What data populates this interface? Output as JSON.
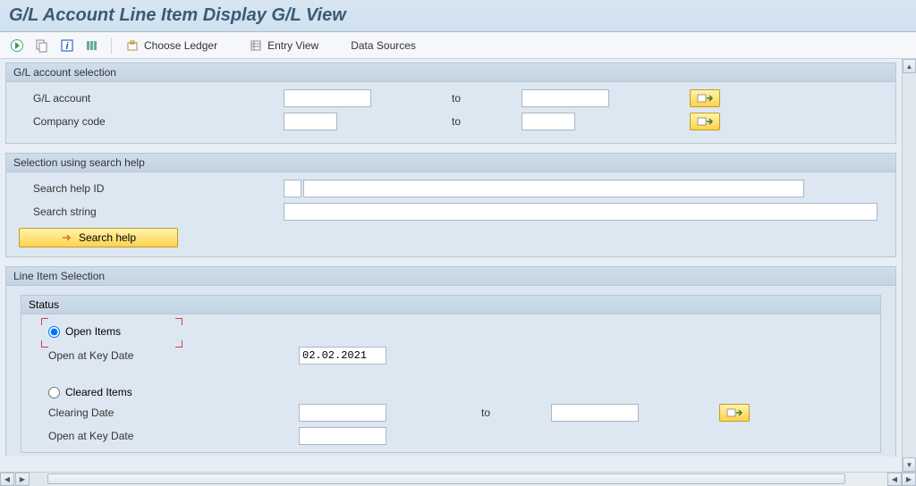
{
  "title": "G/L Account Line Item Display G/L View",
  "toolbar": {
    "choose_ledger": "Choose Ledger",
    "entry_view": "Entry View",
    "data_sources": "Data Sources"
  },
  "group1": {
    "title": "G/L account selection",
    "gl_account_label": "G/L account",
    "gl_account_from": "",
    "gl_account_to": "",
    "company_code_label": "Company code",
    "company_code_from": "",
    "company_code_to": "",
    "to": "to"
  },
  "group2": {
    "title": "Selection using search help",
    "search_help_id_label": "Search help ID",
    "search_help_id": "",
    "search_string_label": "Search string",
    "search_string": "",
    "search_help_btn": "Search help"
  },
  "group3": {
    "title": "Line Item Selection",
    "status_title": "Status",
    "open_items_label": "Open Items",
    "open_at_key_date_label": "Open at Key Date",
    "open_at_key_date": "02.02.2021",
    "cleared_items_label": "Cleared Items",
    "clearing_date_label": "Clearing Date",
    "clearing_date_from": "",
    "clearing_date_to": "",
    "to": "to",
    "open_at_key_date2_label": "Open at Key Date",
    "open_at_key_date2": ""
  }
}
